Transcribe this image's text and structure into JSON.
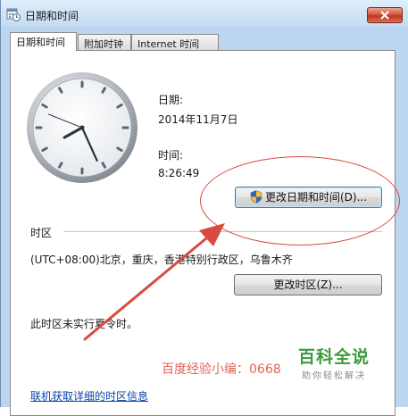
{
  "window": {
    "title": "日期和时间"
  },
  "tabs": [
    {
      "label": "日期和时间",
      "active": true
    },
    {
      "label": "附加时钟",
      "active": false
    },
    {
      "label": "Internet 时间",
      "active": false
    }
  ],
  "datetime": {
    "date_label": "日期:",
    "date_value": "2014年11月7日",
    "time_label": "时间:",
    "time_value": "8:26:49",
    "change_button": "更改日期和时间(D)..."
  },
  "timezone": {
    "section_label": "时区",
    "value": "(UTC+08:00)北京，重庆，香港特别行政区，乌鲁木齐",
    "change_button": "更改时区(Z)...",
    "dst_note": "此时区未实行夏令时。"
  },
  "footer": {
    "link": "联机获取详细的时区信息"
  },
  "annotations": {
    "author": "百度经验小编：0668",
    "logo_main": "百科全说",
    "logo_sub": "助你轻松解决",
    "highlight_color": "#d84a42"
  },
  "icons": {
    "title": "calendar-clock-icon",
    "close": "close-icon",
    "uac": "uac-shield-icon"
  }
}
